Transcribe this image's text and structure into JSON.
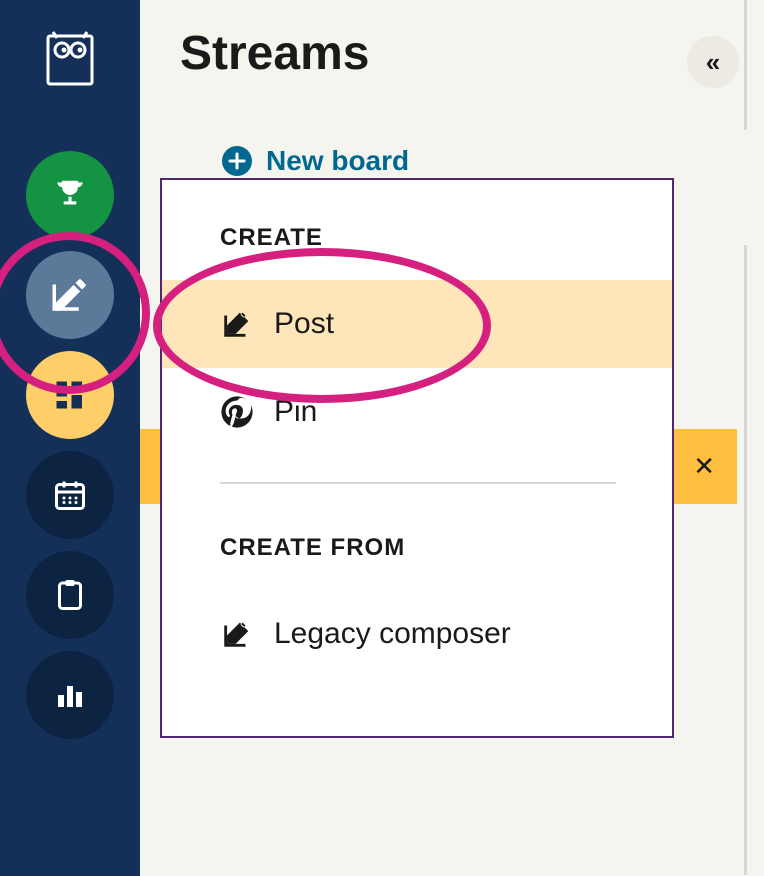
{
  "header": {
    "title": "Streams"
  },
  "newBoard": {
    "label": "New board"
  },
  "popup": {
    "section1Label": "CREATE",
    "section2Label": "CREATE FROM",
    "items": {
      "post": "Post",
      "pin": "Pin",
      "legacy": "Legacy composer"
    }
  }
}
